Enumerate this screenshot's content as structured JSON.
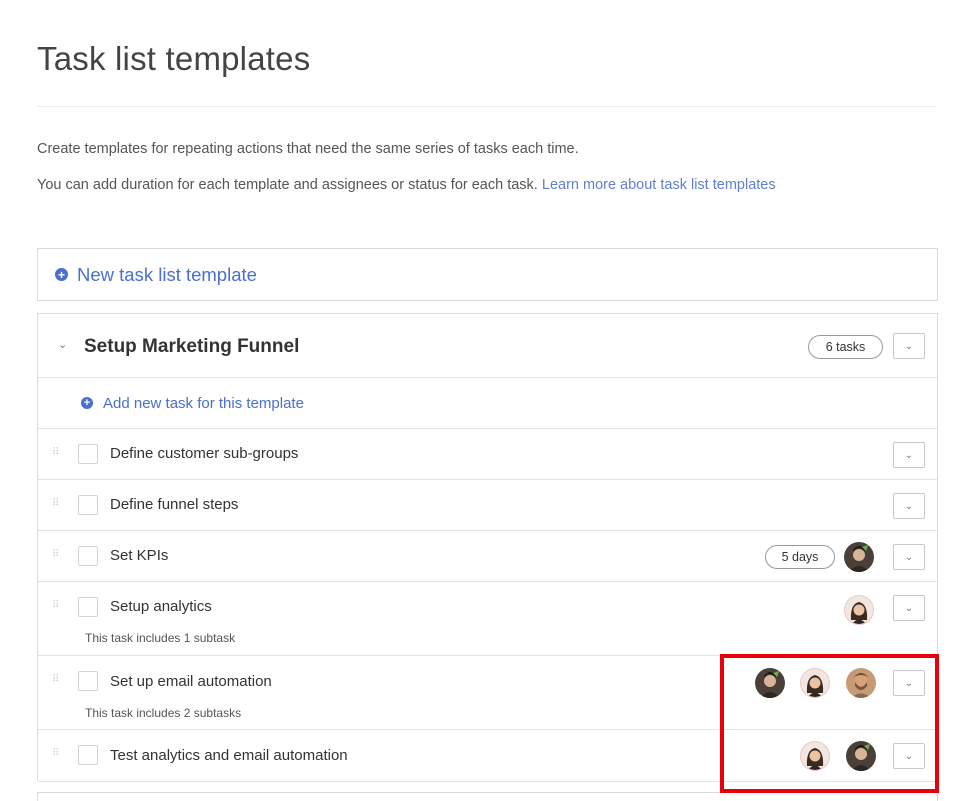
{
  "page": {
    "title": "Task list templates",
    "description_1": "Create templates for repeating actions that need the same series of tasks each time.",
    "description_2": "You can add duration for each template and assignees or status for each task.",
    "learn_more_link": "Learn more about task list templates"
  },
  "new_template": {
    "label": "New task list template",
    "icon": "plus-circle-icon"
  },
  "template": {
    "name": "Setup Marketing Funnel",
    "task_count": "6 tasks",
    "add_task_label": "Add new task for this template",
    "tasks": [
      {
        "name": "Define customer sub-groups",
        "subtask_note": "",
        "duration": "",
        "assignees": []
      },
      {
        "name": "Define funnel steps",
        "subtask_note": "",
        "duration": "",
        "assignees": []
      },
      {
        "name": "Set KPIs",
        "subtask_note": "",
        "duration": "5 days",
        "assignees": [
          "avatar-male-dark"
        ]
      },
      {
        "name": "Setup analytics",
        "subtask_note": "This task includes 1 subtask",
        "duration": "",
        "assignees": [
          "avatar-female"
        ]
      },
      {
        "name": "Set up email automation",
        "subtask_note": "This task includes 2 subtasks",
        "duration": "",
        "assignees": [
          "avatar-male-dark",
          "avatar-female",
          "avatar-male-beard"
        ]
      },
      {
        "name": "Test analytics and email automation",
        "subtask_note": "",
        "duration": "",
        "assignees": [
          "avatar-female",
          "avatar-male-dark"
        ]
      }
    ]
  },
  "colors": {
    "link": "#4a6fd0",
    "highlight": "#e8000b",
    "border": "#dcdcdc"
  },
  "icons": {
    "collapse": "chevron-down-icon",
    "row_menu": "chevron-down-icon",
    "drag": "drag-handle-icon"
  }
}
